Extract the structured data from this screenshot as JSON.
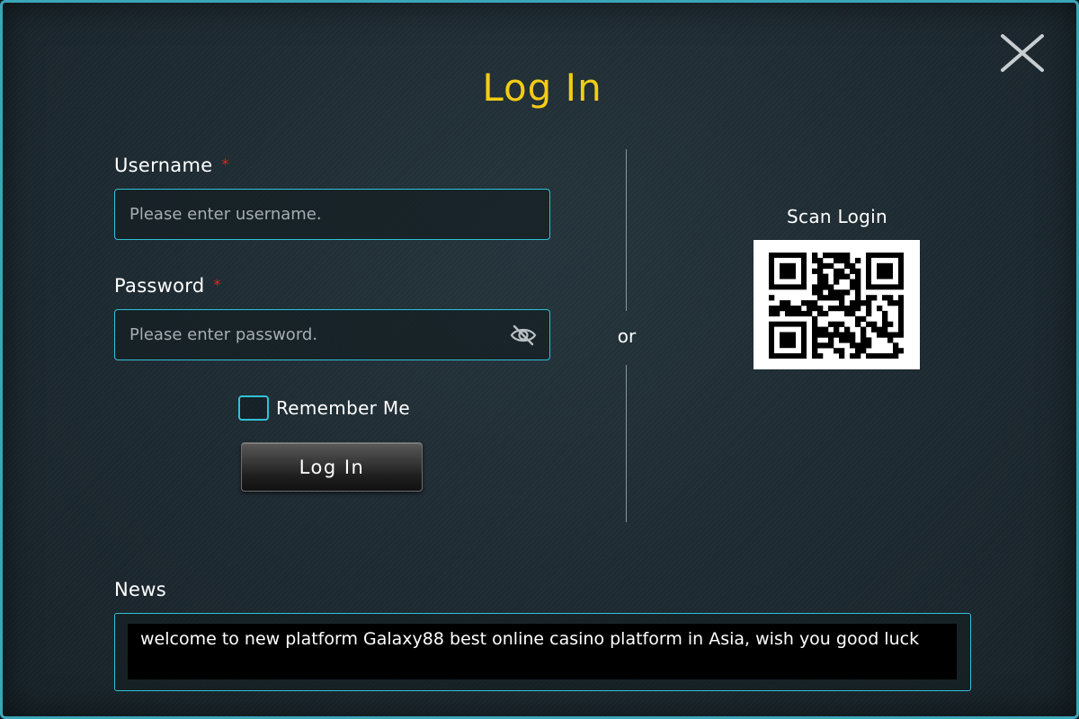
{
  "dialog": {
    "title": "Log In",
    "close_icon": "close-x-icon"
  },
  "form": {
    "username": {
      "label": "Username",
      "required_mark": "*",
      "placeholder": "Please enter username.",
      "value": ""
    },
    "password": {
      "label": "Password",
      "required_mark": "*",
      "placeholder": "Please enter password.",
      "value": "",
      "toggle_icon": "eye-slash-icon"
    },
    "remember": {
      "label": "Remember Me",
      "checked": false
    },
    "submit_label": "Log In"
  },
  "separator": {
    "label": "or"
  },
  "scan": {
    "label": "Scan Login",
    "qr_icon": "qr-code-icon"
  },
  "news": {
    "label": "News",
    "message": "welcome to new platform Galaxy88 best online casino platform in Asia, wish you good luck"
  },
  "colors": {
    "title": "#f3cc14",
    "accent_border": "#2fc2d6",
    "required": "#e02424",
    "text": "#ffffff"
  }
}
